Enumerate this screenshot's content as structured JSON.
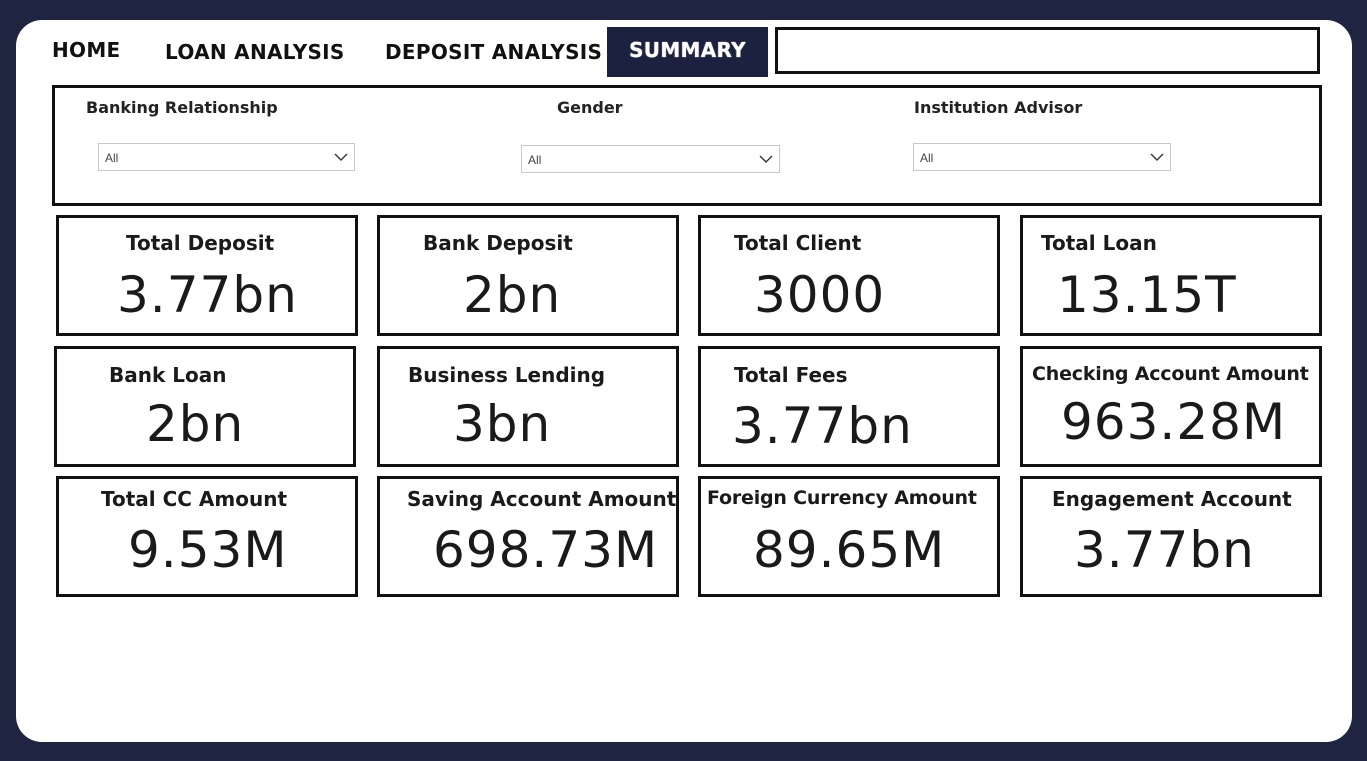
{
  "nav": {
    "tabs": [
      {
        "label": "HOME"
      },
      {
        "label": "LOAN ANALYSIS"
      },
      {
        "label": "DEPOSIT ANALYSIS"
      },
      {
        "label": "SUMMARY",
        "active": true
      }
    ],
    "search_value": ""
  },
  "filters": [
    {
      "title": "Banking Relationship",
      "value": "All"
    },
    {
      "title": "Gender",
      "value": "All"
    },
    {
      "title": "Institution Advisor",
      "value": "All"
    }
  ],
  "cards": [
    {
      "label": "Total Deposit",
      "value": "3.77bn"
    },
    {
      "label": "Bank Deposit",
      "value": "2bn"
    },
    {
      "label": "Total Client",
      "value": "3000"
    },
    {
      "label": "Total Loan",
      "value": "13.15T"
    },
    {
      "label": "Bank Loan",
      "value": "2bn"
    },
    {
      "label": "Business Lending",
      "value": "3bn"
    },
    {
      "label": "Total Fees",
      "value": "3.77bn"
    },
    {
      "label": "Checking Account Amount",
      "value": "963.28M"
    },
    {
      "label": "Total CC Amount",
      "value": "9.53M"
    },
    {
      "label": "Saving Account Amount",
      "value": "698.73M"
    },
    {
      "label": "Foreign Currency Amount",
      "value": "89.65M"
    },
    {
      "label": "Engagement Account",
      "value": "3.77bn"
    }
  ],
  "colors": {
    "background": "#1f2541",
    "active_tab": "#1c2140",
    "canvas": "#ffffff"
  }
}
